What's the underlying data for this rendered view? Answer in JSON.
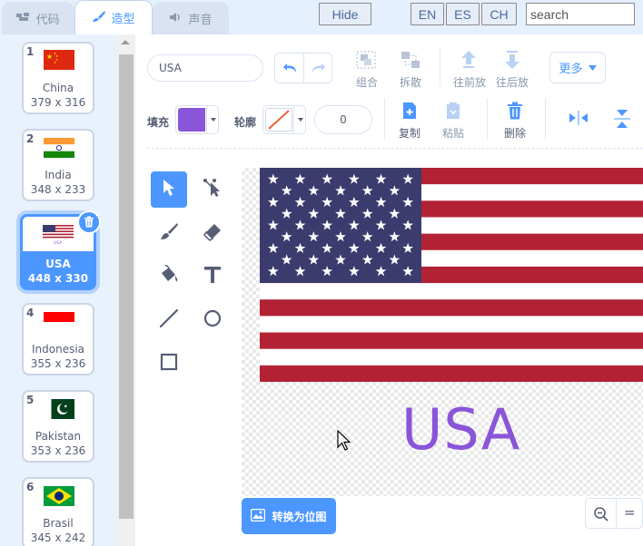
{
  "tabs": [
    {
      "label": "代码",
      "icon": "code-icon"
    },
    {
      "label": "造型",
      "icon": "paintbrush-icon"
    },
    {
      "label": "声音",
      "icon": "speaker-icon"
    }
  ],
  "topbar": {
    "hide_label": "Hide",
    "lang": [
      "EN",
      "ES",
      "CH"
    ],
    "search_placeholder": "search"
  },
  "costumes": [
    {
      "num": "1",
      "name": "China",
      "size": "379 x 316"
    },
    {
      "num": "2",
      "name": "India",
      "size": "348 x 233"
    },
    {
      "num": "3",
      "name": "USA",
      "size": "448 x 330",
      "selected": true
    },
    {
      "num": "4",
      "name": "Indonesia",
      "size": "355 x 236"
    },
    {
      "num": "5",
      "name": "Pakistan",
      "size": "353 x 236"
    },
    {
      "num": "6",
      "name": "Brasil",
      "size": "345 x 242"
    }
  ],
  "editor": {
    "costume_name": "USA",
    "group": "组合",
    "ungroup": "拆散",
    "forward": "往前放",
    "backward": "往后放",
    "more": "更多",
    "fill_label": "填充",
    "outline_label": "轮廓",
    "outline_width": "0",
    "copy": "复制",
    "paste": "粘贴",
    "delete": "删除",
    "convert": "转换为位图",
    "zoom_reset": "="
  },
  "canvas_text": "USA",
  "colors": {
    "accent": "#4c97ff",
    "fill": "#8a55d9",
    "flag_red": "#b22234",
    "flag_blue": "#3c3b6e"
  }
}
